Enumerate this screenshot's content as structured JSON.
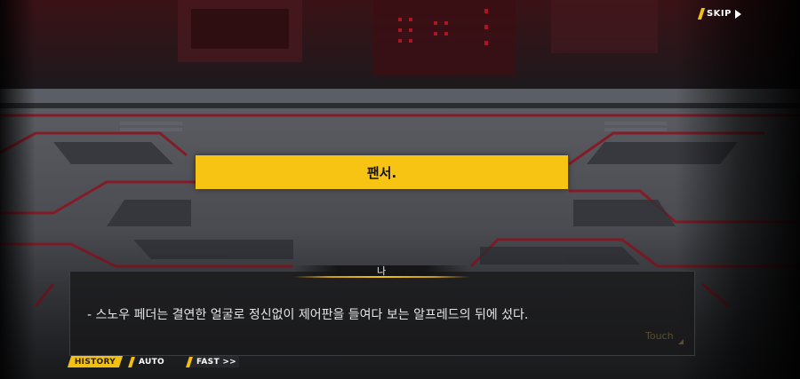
{
  "top_bar": {
    "skip_label": "SKIP"
  },
  "choice": {
    "text": "팬서."
  },
  "dialog": {
    "speaker": "나",
    "text": "- 스노우 페더는 결연한 얼굴로 정신없이 제어판을 들여다 보는 알프레드의 뒤에 섰다.",
    "touch_hint": "Touch"
  },
  "controls": {
    "history_label": "HISTORY",
    "auto_label": "AUTO",
    "fast_label": "FAST >>"
  },
  "colors": {
    "accent": "#f8c413",
    "panel_red": "#8a1622"
  },
  "icons": {
    "skip": "play-triangle-icon",
    "touch": "corner-triangle-icon"
  }
}
